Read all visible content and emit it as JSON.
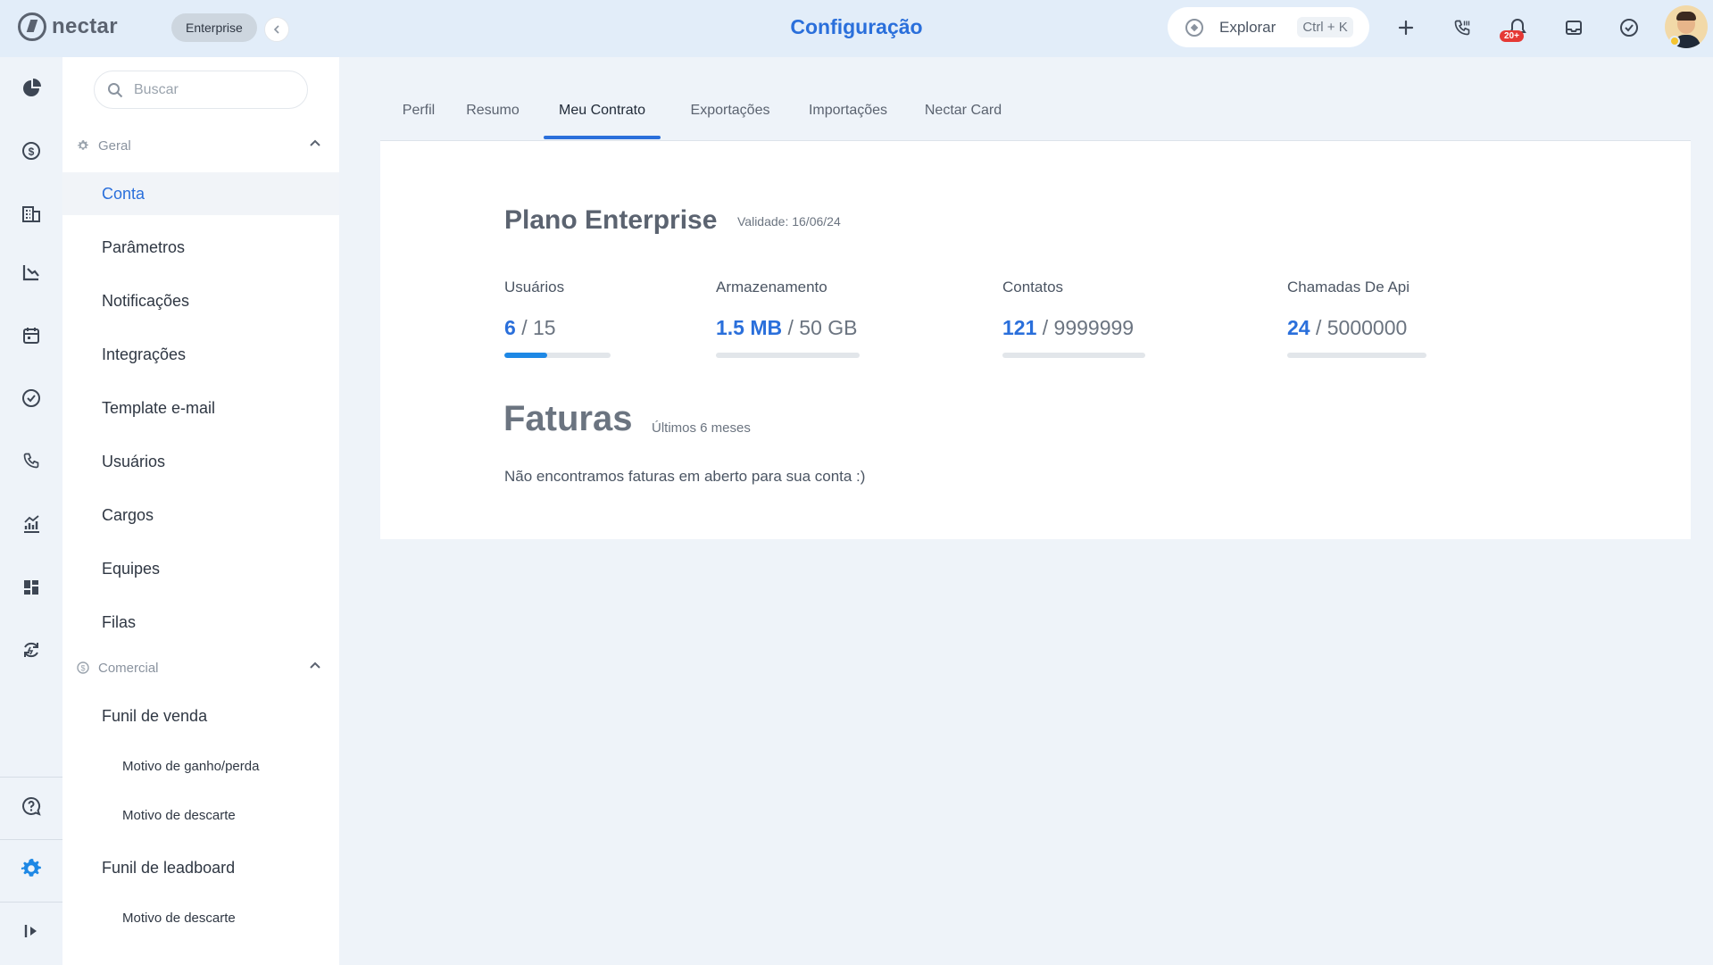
{
  "brand": {
    "name": "nectar",
    "plan_badge": "Enterprise"
  },
  "header": {
    "title": "Configuração",
    "explore": {
      "label": "Explorar",
      "shortcut": "Ctrl + K"
    },
    "notification_badge": "20+",
    "icons": [
      "plus-icon",
      "phone-icon",
      "bell-icon",
      "inbox-icon",
      "check-circle-icon"
    ]
  },
  "rail": {
    "icons": [
      "pie-chart-icon",
      "dollar-icon",
      "building-icon",
      "chart-down-icon",
      "calendar-icon",
      "check-circle-icon",
      "phone-icon",
      "analytics-icon",
      "dashboard-icon",
      "sync-icon",
      "help-icon",
      "settings-icon",
      "expand-icon"
    ]
  },
  "sidebar": {
    "search_placeholder": "Buscar",
    "sections": [
      {
        "title": "Geral",
        "items": [
          "Conta",
          "Parâmetros",
          "Notificações",
          "Integrações",
          "Template e-mail",
          "Usuários",
          "Cargos",
          "Equipes",
          "Filas"
        ]
      },
      {
        "title": "Comercial"
      }
    ],
    "commercial": {
      "funnel_sales": "Funil de venda",
      "sub_win_loss": "Motivo de ganho/perda",
      "sub_discard_1": "Motivo de descarte",
      "funnel_lead": "Funil de leadboard",
      "sub_discard_2": "Motivo de descarte"
    },
    "active_item": "Conta"
  },
  "tabs": [
    "Perfil",
    "Resumo",
    "Meu Contrato",
    "Exportações",
    "Importações",
    "Nectar Card"
  ],
  "active_tab": "Meu Contrato",
  "contract": {
    "plan_title": "Plano Enterprise",
    "validity": "Validade: 16/06/24",
    "metrics": [
      {
        "label": "Usuários",
        "used": "6",
        "total": "/ 15",
        "percent": 40
      },
      {
        "label": "Armazenamento",
        "used": "1.5 MB",
        "total": "/ 50 GB",
        "percent": 0
      },
      {
        "label": "Contatos",
        "used": "121",
        "total": "/ 9999999",
        "percent": 0
      },
      {
        "label": "Chamadas De Api",
        "used": "24",
        "total": "/ 5000000",
        "percent": 0
      }
    ]
  },
  "invoices": {
    "title": "Faturas",
    "subtitle": "Últimos 6 meses",
    "empty_message": "Não encontramos faturas em aberto para sua conta :)"
  },
  "colors": {
    "accent": "#2a6fdb",
    "progress": "#1e88e5",
    "badge": "#e53935"
  }
}
